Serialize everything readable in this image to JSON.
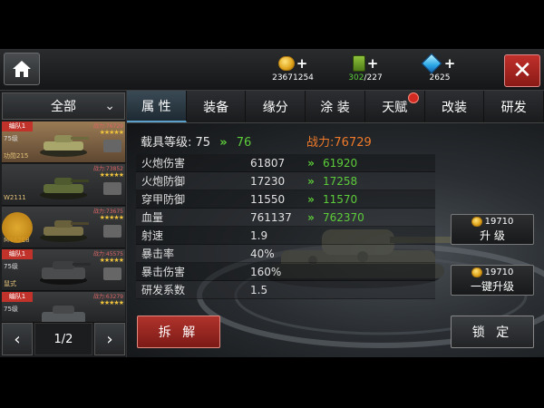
{
  "resources": {
    "gold": "23671254",
    "fuel_current": "302",
    "fuel_max": "/227",
    "diamonds": "2625",
    "plus": "+"
  },
  "nav": {
    "close_symbol": "✕"
  },
  "filter": {
    "label": "全部"
  },
  "tank_list": [
    {
      "badge": "编队1",
      "level": "75级",
      "name": "功勋215",
      "power": "战力:76729",
      "stars": "★★★★★"
    },
    {
      "badge": "",
      "level": "",
      "name": "W2111",
      "power": "战力:73852",
      "stars": "★★★★★"
    },
    {
      "badge": "",
      "level": "",
      "name": "M4A2E8",
      "power": "战力:73675",
      "stars": "★★★★★"
    },
    {
      "badge": "编队1",
      "level": "75级",
      "name": "鼠式",
      "power": "战力:45575",
      "stars": "★★★★★"
    },
    {
      "badge": "编队1",
      "level": "75级",
      "name": "",
      "power": "战力:63279",
      "stars": "★★★★★"
    }
  ],
  "pager": {
    "current": "1/2",
    "prev": "‹",
    "next": "›"
  },
  "tabs": [
    {
      "label": "属 性",
      "active": true
    },
    {
      "label": "装备"
    },
    {
      "label": "缘分"
    },
    {
      "label": "涂 装"
    },
    {
      "label": "天赋",
      "badge": true
    },
    {
      "label": "改装"
    },
    {
      "label": "研发"
    }
  ],
  "vehicle": {
    "level_label": "载具等级:",
    "level_current": "75",
    "level_arrow": "»",
    "level_next": "76",
    "power_label": "战力:76729"
  },
  "stats": [
    {
      "name": "火炮伤害",
      "value": "61807",
      "arrow": "»",
      "next": "61920"
    },
    {
      "name": "火炮防御",
      "value": "17230",
      "arrow": "»",
      "next": "17258"
    },
    {
      "name": "穿甲防御",
      "value": "11550",
      "arrow": "»",
      "next": "11570"
    },
    {
      "name": "血量",
      "value": "761137",
      "arrow": "»",
      "next": "762370"
    },
    {
      "name": "射速",
      "value": "1.9",
      "arrow": "",
      "next": ""
    },
    {
      "name": "暴击率",
      "value": "40%",
      "arrow": "",
      "next": ""
    },
    {
      "name": "暴击伤害",
      "value": "160%",
      "arrow": "",
      "next": ""
    },
    {
      "name": "研发系数",
      "value": "1.5",
      "arrow": "",
      "next": ""
    }
  ],
  "actions": {
    "upgrade_cost": "19710",
    "upgrade_label": "升 级",
    "oneclick_cost": "19710",
    "oneclick_label": "一键升级",
    "dismantle_label": "拆 解",
    "lock_label": "锁 定"
  }
}
